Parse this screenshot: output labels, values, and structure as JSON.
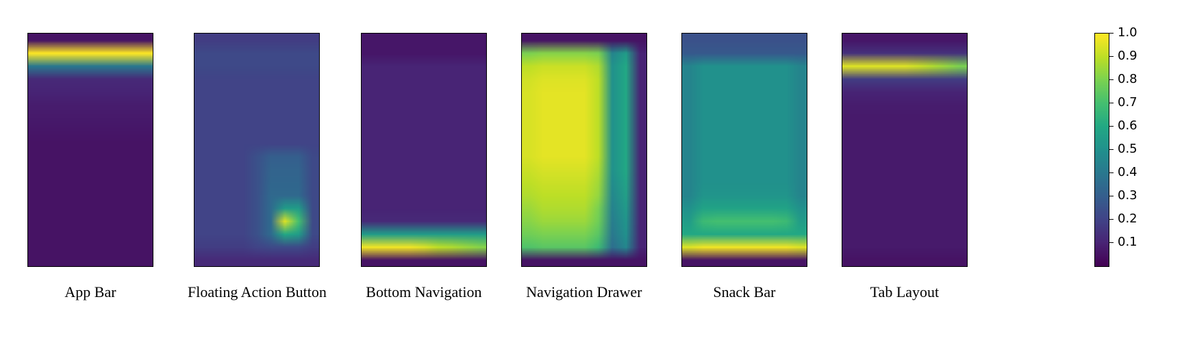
{
  "chart_data": [
    {
      "type": "heatmap",
      "title": "App Bar",
      "width_cells": 9,
      "height_cells": 18,
      "vmin": 0.0,
      "vmax": 1.0
    },
    {
      "type": "heatmap",
      "title": "Floating Action Button",
      "width_cells": 9,
      "height_cells": 18,
      "vmin": 0.0,
      "vmax": 1.0
    },
    {
      "type": "heatmap",
      "title": "Bottom Navigation",
      "width_cells": 9,
      "height_cells": 18,
      "vmin": 0.0,
      "vmax": 1.0
    },
    {
      "type": "heatmap",
      "title": "Navigation Drawer",
      "width_cells": 9,
      "height_cells": 18,
      "vmin": 0.0,
      "vmax": 1.0
    },
    {
      "type": "heatmap",
      "title": "Snack Bar",
      "width_cells": 9,
      "height_cells": 18,
      "vmin": 0.0,
      "vmax": 1.0
    },
    {
      "type": "heatmap",
      "title": "Tab Layout",
      "width_cells": 9,
      "height_cells": 18,
      "vmin": 0.0,
      "vmax": 1.0
    }
  ],
  "colorbar": {
    "ticks": [
      0.1,
      0.2,
      0.3,
      0.4,
      0.5,
      0.6,
      0.7,
      0.8,
      0.9,
      1.0
    ],
    "vmin": 0.0,
    "vmax": 1.0,
    "cmap": "viridis"
  },
  "panels": {
    "0": {
      "label": "App Bar"
    },
    "1": {
      "label": "Floating Action Button"
    },
    "2": {
      "label": "Bottom Navigation"
    },
    "3": {
      "label": "Navigation Drawer"
    },
    "4": {
      "label": "Snack Bar"
    },
    "5": {
      "label": "Tab Layout"
    }
  },
  "heatmap_values": {
    "app_bar": [
      [
        0.05,
        0.05,
        0.05,
        0.05,
        0.05,
        0.05,
        0.05,
        0.05,
        0.05
      ],
      [
        1.0,
        1.0,
        1.0,
        1.0,
        1.0,
        1.0,
        1.0,
        1.0,
        1.0
      ],
      [
        0.4,
        0.4,
        0.4,
        0.4,
        0.4,
        0.4,
        0.4,
        0.4,
        0.4
      ],
      [
        0.12,
        0.12,
        0.12,
        0.12,
        0.12,
        0.12,
        0.12,
        0.12,
        0.12
      ],
      [
        0.1,
        0.1,
        0.1,
        0.1,
        0.1,
        0.1,
        0.1,
        0.1,
        0.1
      ],
      [
        0.08,
        0.08,
        0.08,
        0.08,
        0.08,
        0.08,
        0.08,
        0.08,
        0.08
      ],
      [
        0.07,
        0.07,
        0.07,
        0.07,
        0.07,
        0.07,
        0.07,
        0.07,
        0.07
      ],
      [
        0.06,
        0.06,
        0.06,
        0.06,
        0.06,
        0.06,
        0.06,
        0.06,
        0.06
      ],
      [
        0.05,
        0.05,
        0.05,
        0.05,
        0.05,
        0.05,
        0.05,
        0.05,
        0.05
      ],
      [
        0.05,
        0.05,
        0.05,
        0.05,
        0.05,
        0.05,
        0.05,
        0.05,
        0.05
      ],
      [
        0.05,
        0.05,
        0.05,
        0.05,
        0.05,
        0.05,
        0.05,
        0.05,
        0.05
      ],
      [
        0.05,
        0.05,
        0.05,
        0.05,
        0.05,
        0.05,
        0.05,
        0.05,
        0.05
      ],
      [
        0.05,
        0.05,
        0.05,
        0.05,
        0.05,
        0.05,
        0.05,
        0.05,
        0.05
      ],
      [
        0.05,
        0.05,
        0.05,
        0.05,
        0.05,
        0.05,
        0.05,
        0.05,
        0.05
      ],
      [
        0.05,
        0.05,
        0.05,
        0.05,
        0.05,
        0.05,
        0.05,
        0.05,
        0.05
      ],
      [
        0.05,
        0.05,
        0.05,
        0.05,
        0.05,
        0.05,
        0.05,
        0.05,
        0.05
      ],
      [
        0.05,
        0.05,
        0.05,
        0.05,
        0.05,
        0.05,
        0.05,
        0.05,
        0.05
      ],
      [
        0.05,
        0.05,
        0.05,
        0.05,
        0.05,
        0.05,
        0.05,
        0.05,
        0.05
      ]
    ],
    "fab": [
      [
        0.18,
        0.18,
        0.18,
        0.18,
        0.18,
        0.18,
        0.18,
        0.18,
        0.18
      ],
      [
        0.22,
        0.22,
        0.22,
        0.22,
        0.22,
        0.22,
        0.22,
        0.22,
        0.22
      ],
      [
        0.22,
        0.22,
        0.22,
        0.22,
        0.22,
        0.22,
        0.22,
        0.22,
        0.22
      ],
      [
        0.2,
        0.2,
        0.2,
        0.2,
        0.2,
        0.2,
        0.2,
        0.2,
        0.2
      ],
      [
        0.2,
        0.2,
        0.2,
        0.2,
        0.2,
        0.2,
        0.2,
        0.2,
        0.2
      ],
      [
        0.2,
        0.2,
        0.2,
        0.2,
        0.2,
        0.2,
        0.2,
        0.2,
        0.2
      ],
      [
        0.2,
        0.2,
        0.2,
        0.2,
        0.2,
        0.2,
        0.2,
        0.2,
        0.2
      ],
      [
        0.2,
        0.2,
        0.2,
        0.2,
        0.2,
        0.2,
        0.2,
        0.2,
        0.2
      ],
      [
        0.2,
        0.2,
        0.2,
        0.2,
        0.2,
        0.2,
        0.2,
        0.2,
        0.2
      ],
      [
        0.2,
        0.2,
        0.2,
        0.2,
        0.25,
        0.3,
        0.3,
        0.3,
        0.22
      ],
      [
        0.2,
        0.2,
        0.2,
        0.2,
        0.25,
        0.32,
        0.32,
        0.32,
        0.22
      ],
      [
        0.2,
        0.2,
        0.2,
        0.2,
        0.25,
        0.33,
        0.33,
        0.33,
        0.22
      ],
      [
        0.2,
        0.2,
        0.2,
        0.2,
        0.25,
        0.34,
        0.34,
        0.34,
        0.22
      ],
      [
        0.2,
        0.2,
        0.2,
        0.2,
        0.25,
        0.35,
        0.55,
        0.55,
        0.22
      ],
      [
        0.2,
        0.2,
        0.2,
        0.2,
        0.25,
        0.35,
        0.95,
        0.7,
        0.22
      ],
      [
        0.2,
        0.2,
        0.2,
        0.2,
        0.25,
        0.35,
        0.6,
        0.55,
        0.22
      ],
      [
        0.18,
        0.18,
        0.18,
        0.18,
        0.2,
        0.22,
        0.22,
        0.22,
        0.18
      ],
      [
        0.12,
        0.12,
        0.12,
        0.12,
        0.12,
        0.12,
        0.12,
        0.12,
        0.12
      ]
    ],
    "bottom_nav": [
      [
        0.06,
        0.06,
        0.06,
        0.06,
        0.06,
        0.06,
        0.06,
        0.06,
        0.06
      ],
      [
        0.06,
        0.06,
        0.06,
        0.06,
        0.06,
        0.06,
        0.06,
        0.06,
        0.06
      ],
      [
        0.1,
        0.1,
        0.1,
        0.1,
        0.1,
        0.1,
        0.1,
        0.1,
        0.1
      ],
      [
        0.1,
        0.1,
        0.1,
        0.1,
        0.1,
        0.1,
        0.1,
        0.1,
        0.1
      ],
      [
        0.1,
        0.1,
        0.1,
        0.1,
        0.1,
        0.1,
        0.1,
        0.1,
        0.1
      ],
      [
        0.1,
        0.1,
        0.1,
        0.1,
        0.1,
        0.1,
        0.1,
        0.1,
        0.1
      ],
      [
        0.1,
        0.1,
        0.1,
        0.1,
        0.1,
        0.1,
        0.1,
        0.1,
        0.1
      ],
      [
        0.1,
        0.1,
        0.1,
        0.1,
        0.1,
        0.1,
        0.1,
        0.1,
        0.1
      ],
      [
        0.1,
        0.1,
        0.1,
        0.1,
        0.1,
        0.1,
        0.1,
        0.1,
        0.1
      ],
      [
        0.1,
        0.1,
        0.1,
        0.1,
        0.1,
        0.1,
        0.1,
        0.1,
        0.1
      ],
      [
        0.1,
        0.1,
        0.1,
        0.1,
        0.1,
        0.1,
        0.1,
        0.1,
        0.1
      ],
      [
        0.1,
        0.1,
        0.1,
        0.1,
        0.1,
        0.1,
        0.1,
        0.1,
        0.1
      ],
      [
        0.1,
        0.1,
        0.1,
        0.1,
        0.1,
        0.1,
        0.1,
        0.1,
        0.1
      ],
      [
        0.1,
        0.1,
        0.1,
        0.1,
        0.1,
        0.1,
        0.1,
        0.1,
        0.1
      ],
      [
        0.12,
        0.12,
        0.12,
        0.12,
        0.12,
        0.12,
        0.12,
        0.12,
        0.12
      ],
      [
        0.55,
        0.55,
        0.55,
        0.55,
        0.55,
        0.55,
        0.55,
        0.55,
        0.55
      ],
      [
        0.98,
        0.98,
        0.98,
        0.98,
        0.95,
        0.9,
        0.88,
        0.85,
        0.82
      ],
      [
        0.05,
        0.05,
        0.05,
        0.05,
        0.05,
        0.05,
        0.05,
        0.05,
        0.05
      ]
    ],
    "nav_drawer": [
      [
        0.05,
        0.05,
        0.05,
        0.05,
        0.05,
        0.05,
        0.05,
        0.05,
        0.05
      ],
      [
        0.8,
        0.82,
        0.82,
        0.82,
        0.82,
        0.8,
        0.45,
        0.55,
        0.1
      ],
      [
        0.9,
        0.92,
        0.92,
        0.92,
        0.92,
        0.88,
        0.5,
        0.6,
        0.1
      ],
      [
        0.93,
        0.95,
        0.95,
        0.95,
        0.95,
        0.9,
        0.5,
        0.6,
        0.1
      ],
      [
        0.94,
        0.96,
        0.96,
        0.96,
        0.96,
        0.9,
        0.5,
        0.6,
        0.1
      ],
      [
        0.94,
        0.96,
        0.96,
        0.96,
        0.96,
        0.9,
        0.5,
        0.6,
        0.1
      ],
      [
        0.94,
        0.96,
        0.96,
        0.96,
        0.96,
        0.9,
        0.5,
        0.6,
        0.1
      ],
      [
        0.94,
        0.96,
        0.96,
        0.96,
        0.96,
        0.9,
        0.5,
        0.6,
        0.1
      ],
      [
        0.94,
        0.96,
        0.96,
        0.96,
        0.96,
        0.9,
        0.5,
        0.6,
        0.1
      ],
      [
        0.94,
        0.96,
        0.96,
        0.96,
        0.96,
        0.9,
        0.5,
        0.6,
        0.1
      ],
      [
        0.92,
        0.94,
        0.94,
        0.94,
        0.94,
        0.88,
        0.5,
        0.6,
        0.1
      ],
      [
        0.9,
        0.92,
        0.92,
        0.92,
        0.92,
        0.86,
        0.48,
        0.58,
        0.1
      ],
      [
        0.88,
        0.9,
        0.9,
        0.9,
        0.9,
        0.84,
        0.46,
        0.56,
        0.1
      ],
      [
        0.85,
        0.88,
        0.88,
        0.88,
        0.88,
        0.8,
        0.44,
        0.54,
        0.1
      ],
      [
        0.82,
        0.85,
        0.85,
        0.85,
        0.85,
        0.78,
        0.42,
        0.52,
        0.1
      ],
      [
        0.78,
        0.8,
        0.8,
        0.8,
        0.8,
        0.74,
        0.4,
        0.5,
        0.1
      ],
      [
        0.72,
        0.74,
        0.74,
        0.74,
        0.74,
        0.68,
        0.36,
        0.46,
        0.1
      ],
      [
        0.05,
        0.05,
        0.05,
        0.05,
        0.05,
        0.05,
        0.05,
        0.05,
        0.05
      ]
    ],
    "snack_bar": [
      [
        0.25,
        0.25,
        0.25,
        0.25,
        0.25,
        0.25,
        0.25,
        0.25,
        0.25
      ],
      [
        0.28,
        0.28,
        0.28,
        0.28,
        0.28,
        0.28,
        0.28,
        0.28,
        0.28
      ],
      [
        0.45,
        0.5,
        0.5,
        0.5,
        0.5,
        0.5,
        0.5,
        0.5,
        0.45
      ],
      [
        0.45,
        0.5,
        0.5,
        0.5,
        0.5,
        0.5,
        0.5,
        0.5,
        0.45
      ],
      [
        0.45,
        0.5,
        0.5,
        0.5,
        0.5,
        0.5,
        0.5,
        0.5,
        0.45
      ],
      [
        0.45,
        0.5,
        0.5,
        0.5,
        0.5,
        0.5,
        0.5,
        0.5,
        0.45
      ],
      [
        0.45,
        0.5,
        0.5,
        0.5,
        0.5,
        0.5,
        0.5,
        0.5,
        0.45
      ],
      [
        0.45,
        0.5,
        0.5,
        0.5,
        0.5,
        0.5,
        0.5,
        0.5,
        0.45
      ],
      [
        0.45,
        0.5,
        0.5,
        0.5,
        0.5,
        0.5,
        0.5,
        0.5,
        0.45
      ],
      [
        0.45,
        0.5,
        0.5,
        0.5,
        0.5,
        0.5,
        0.5,
        0.5,
        0.45
      ],
      [
        0.45,
        0.5,
        0.5,
        0.5,
        0.5,
        0.5,
        0.5,
        0.5,
        0.45
      ],
      [
        0.45,
        0.5,
        0.5,
        0.5,
        0.5,
        0.5,
        0.5,
        0.5,
        0.45
      ],
      [
        0.45,
        0.52,
        0.52,
        0.52,
        0.52,
        0.52,
        0.52,
        0.52,
        0.45
      ],
      [
        0.5,
        0.58,
        0.58,
        0.58,
        0.58,
        0.58,
        0.58,
        0.58,
        0.5
      ],
      [
        0.55,
        0.68,
        0.7,
        0.7,
        0.7,
        0.7,
        0.7,
        0.68,
        0.55
      ],
      [
        0.6,
        0.6,
        0.6,
        0.6,
        0.6,
        0.6,
        0.6,
        0.6,
        0.6
      ],
      [
        0.95,
        0.98,
        0.98,
        0.98,
        0.98,
        0.98,
        0.98,
        0.98,
        0.95
      ],
      [
        0.05,
        0.05,
        0.05,
        0.05,
        0.05,
        0.05,
        0.05,
        0.05,
        0.05
      ]
    ],
    "tab_layout": [
      [
        0.06,
        0.06,
        0.06,
        0.06,
        0.06,
        0.06,
        0.06,
        0.06,
        0.06
      ],
      [
        0.14,
        0.14,
        0.14,
        0.14,
        0.14,
        0.14,
        0.14,
        0.14,
        0.14
      ],
      [
        0.95,
        0.95,
        0.95,
        0.95,
        0.95,
        0.92,
        0.88,
        0.84,
        0.8
      ],
      [
        0.18,
        0.18,
        0.18,
        0.18,
        0.18,
        0.18,
        0.18,
        0.18,
        0.18
      ],
      [
        0.1,
        0.1,
        0.1,
        0.1,
        0.1,
        0.1,
        0.1,
        0.1,
        0.1
      ],
      [
        0.08,
        0.08,
        0.08,
        0.08,
        0.08,
        0.08,
        0.08,
        0.08,
        0.08
      ],
      [
        0.07,
        0.07,
        0.07,
        0.07,
        0.07,
        0.07,
        0.07,
        0.07,
        0.07
      ],
      [
        0.07,
        0.07,
        0.07,
        0.07,
        0.07,
        0.07,
        0.07,
        0.07,
        0.07
      ],
      [
        0.07,
        0.07,
        0.07,
        0.07,
        0.07,
        0.07,
        0.07,
        0.07,
        0.07
      ],
      [
        0.07,
        0.07,
        0.07,
        0.07,
        0.07,
        0.07,
        0.07,
        0.07,
        0.07
      ],
      [
        0.07,
        0.07,
        0.07,
        0.07,
        0.07,
        0.07,
        0.07,
        0.07,
        0.07
      ],
      [
        0.07,
        0.07,
        0.07,
        0.07,
        0.07,
        0.07,
        0.07,
        0.07,
        0.07
      ],
      [
        0.07,
        0.07,
        0.07,
        0.07,
        0.07,
        0.07,
        0.07,
        0.07,
        0.07
      ],
      [
        0.07,
        0.07,
        0.07,
        0.07,
        0.07,
        0.07,
        0.07,
        0.07,
        0.07
      ],
      [
        0.07,
        0.07,
        0.07,
        0.07,
        0.07,
        0.07,
        0.07,
        0.07,
        0.07
      ],
      [
        0.07,
        0.07,
        0.07,
        0.07,
        0.07,
        0.07,
        0.07,
        0.07,
        0.07
      ],
      [
        0.07,
        0.07,
        0.07,
        0.07,
        0.07,
        0.07,
        0.07,
        0.07,
        0.07
      ],
      [
        0.05,
        0.05,
        0.05,
        0.05,
        0.05,
        0.05,
        0.05,
        0.05,
        0.05
      ]
    ]
  }
}
